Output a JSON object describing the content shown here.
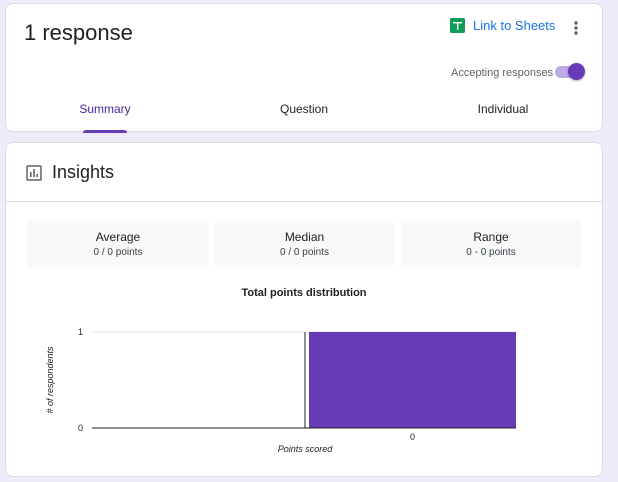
{
  "header": {
    "response_count": "1 response",
    "link_to_sheets": "Link to Sheets",
    "accepting_responses": "Accepting responses",
    "accepting_enabled": true
  },
  "tabs": [
    {
      "label": "Summary",
      "active": true
    },
    {
      "label": "Question",
      "active": false
    },
    {
      "label": "Individual",
      "active": false
    }
  ],
  "insights": {
    "title": "Insights",
    "stats": [
      {
        "label": "Average",
        "value": "0 / 0 points"
      },
      {
        "label": "Median",
        "value": "0 / 0 points"
      },
      {
        "label": "Range",
        "value": "0 - 0 points"
      }
    ]
  },
  "colors": {
    "accent": "#673ab7",
    "link": "#1a73e8",
    "sheets_green": "#0f9d58",
    "page_bg": "#f0ebf8"
  },
  "icons": {
    "sheets": "google-sheets-icon",
    "more": "more-vert-icon",
    "insights": "bar-chart-icon"
  },
  "chart_data": {
    "type": "bar",
    "title": "Total points distribution",
    "xlabel": "Points scored",
    "ylabel": "# of respondents",
    "categories": [
      "0"
    ],
    "values": [
      1
    ],
    "ylim": [
      0,
      1
    ],
    "yticks": [
      0,
      1
    ],
    "bar_color": "#673ab7",
    "grid": true
  }
}
